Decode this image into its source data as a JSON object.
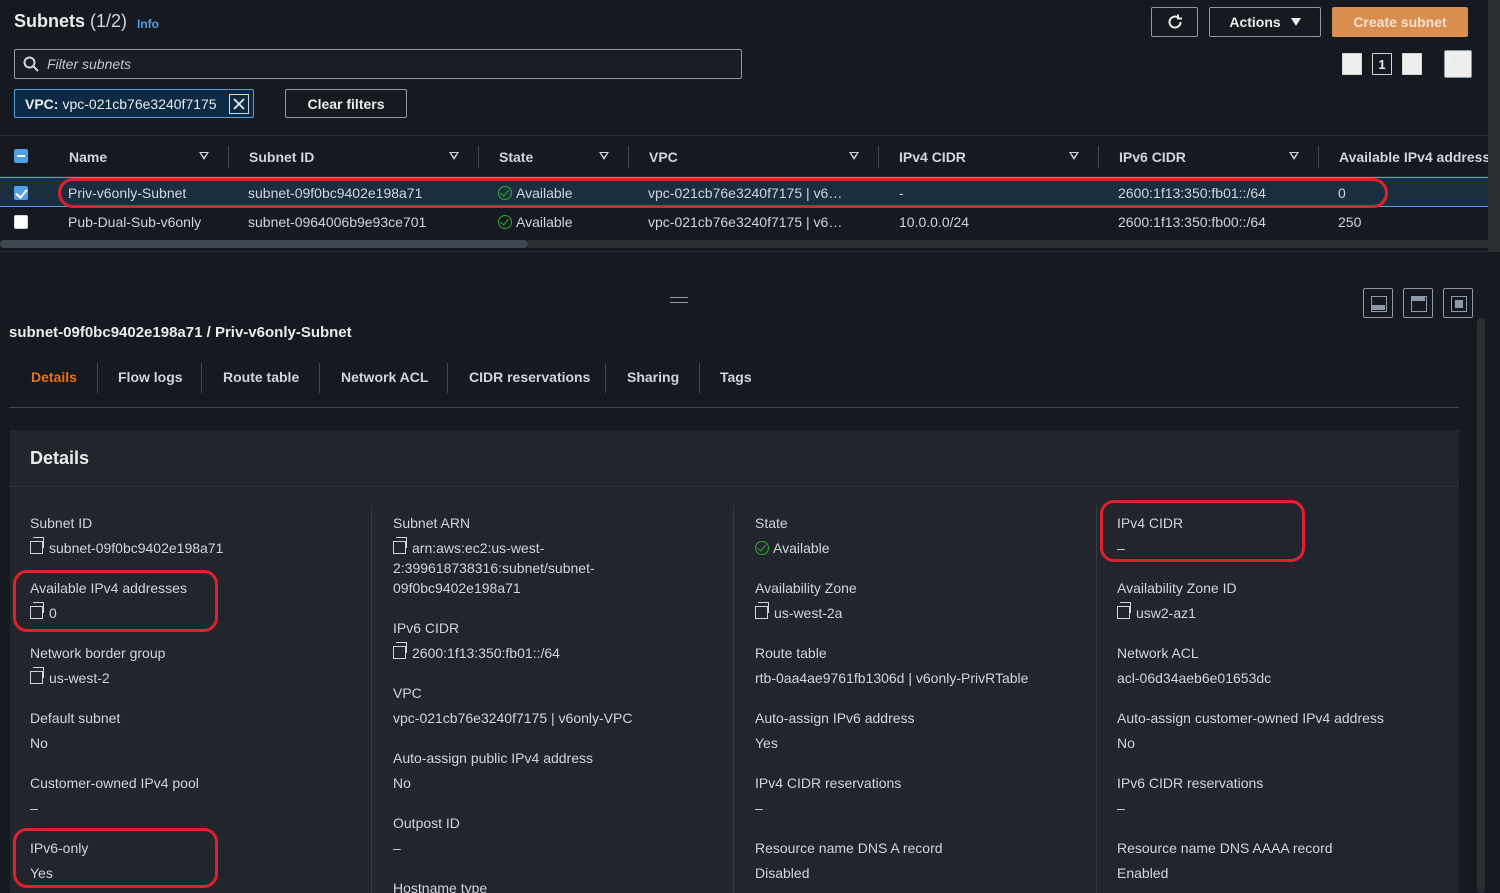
{
  "header": {
    "title": "Subnets",
    "count": "(1/2)",
    "info": "Info",
    "actions": "Actions",
    "create": "Create subnet"
  },
  "filter": {
    "placeholder": "Filter subnets"
  },
  "pagination": {
    "page": "1"
  },
  "token": {
    "key": "VPC:",
    "value": "vpc-021cb76e3240f7175"
  },
  "clear_filters": "Clear filters",
  "columns": [
    "Name",
    "Subnet ID",
    "State",
    "VPC",
    "IPv4 CIDR",
    "IPv6 CIDR",
    "Available IPv4 address"
  ],
  "rows": [
    {
      "name": "Priv-v6only-Subnet",
      "id": "subnet-09f0bc9402e198a71",
      "state": "Available",
      "vpc": "vpc-021cb76e3240f7175 | v6…",
      "ipv4": "-",
      "ipv6": "2600:1f13:350:fb01::/64",
      "avail": "0"
    },
    {
      "name": "Pub-Dual-Sub-v6only",
      "id": "subnet-0964006b9e93ce701",
      "state": "Available",
      "vpc": "vpc-021cb76e3240f7175 | v6…",
      "ipv4": "10.0.0.0/24",
      "ipv6": "2600:1f13:350:fb00::/64",
      "avail": "250"
    }
  ],
  "detail": {
    "breadcrumb": "subnet-09f0bc9402e198a71 / Priv-v6only-Subnet",
    "tabs": [
      "Details",
      "Flow logs",
      "Route table",
      "Network ACL",
      "CIDR reservations",
      "Sharing",
      "Tags"
    ],
    "card_title": "Details",
    "col1": [
      {
        "label": "Subnet ID",
        "value": "subnet-09f0bc9402e198a71"
      },
      {
        "label": "Available IPv4 addresses",
        "value": "0"
      },
      {
        "label": "Network border group",
        "value": "us-west-2"
      },
      {
        "label": "Default subnet",
        "value": "No"
      },
      {
        "label": "Customer-owned IPv4 pool",
        "value": "–"
      },
      {
        "label": "IPv6-only",
        "value": "Yes"
      }
    ],
    "col2": [
      {
        "label": "Subnet ARN",
        "value1": "arn:aws:ec2:us-west-",
        "value2": "2:399618738316:subnet/subnet-",
        "value3": "09f0bc9402e198a71"
      },
      {
        "label": "IPv6 CIDR",
        "value": "2600:1f13:350:fb01::/64"
      },
      {
        "label": "VPC",
        "value": "vpc-021cb76e3240f7175 | v6only-VPC"
      },
      {
        "label": "Auto-assign public IPv4 address",
        "value": "No"
      },
      {
        "label": "Outpost ID",
        "value": "–"
      },
      {
        "label": "Hostname type",
        "value": ""
      }
    ],
    "col3": [
      {
        "label": "State",
        "value": "Available"
      },
      {
        "label": "Availability Zone",
        "value": "us-west-2a"
      },
      {
        "label": "Route table",
        "value": "rtb-0aa4ae9761fb1306d | v6only-PrivRTable"
      },
      {
        "label": "Auto-assign IPv6 address",
        "value": "Yes"
      },
      {
        "label": "IPv4 CIDR reservations",
        "value": "–"
      },
      {
        "label": "Resource name DNS A record",
        "value": "Disabled"
      }
    ],
    "col4": [
      {
        "label": "IPv4 CIDR",
        "value": "–"
      },
      {
        "label": "Availability Zone ID",
        "value": "usw2-az1"
      },
      {
        "label": "Network ACL",
        "value": "acl-06d34aeb6e01653dc"
      },
      {
        "label": "Auto-assign customer-owned IPv4 address",
        "value": "No"
      },
      {
        "label": "IPv6 CIDR reservations",
        "value": "–"
      },
      {
        "label": "Resource name DNS AAAA record",
        "value": "Enabled"
      }
    ]
  },
  "colors": {
    "accent": "#ec7211",
    "create_button": "#d98e4f",
    "link": "#539fe5",
    "highlight": "#e0202d",
    "success": "#29ad32"
  }
}
